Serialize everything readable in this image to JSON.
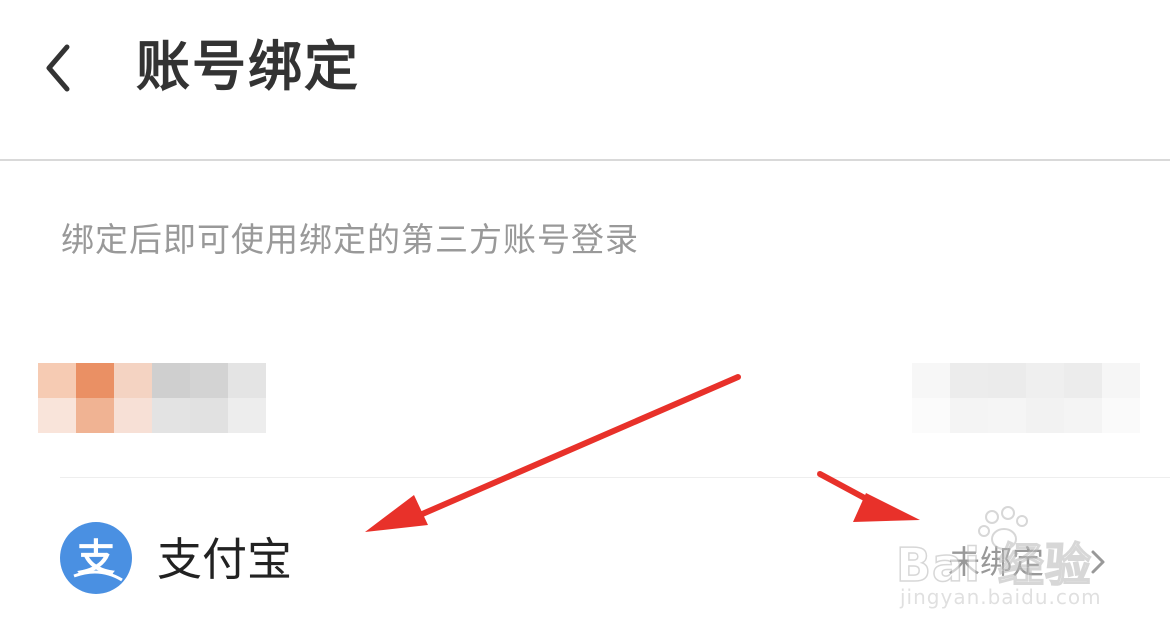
{
  "header": {
    "back_icon": "chevron-left-icon",
    "title": "账号绑定"
  },
  "hint": "绑定后即可使用绑定的第三方账号登录",
  "accounts": [
    {
      "obscured": true
    },
    {
      "icon": "alipay-icon",
      "icon_color": "#4a90e2",
      "icon_glyph": "支",
      "label": "支付宝",
      "status": "未绑定",
      "chevron": "chevron-right-icon"
    }
  ],
  "annotations": {
    "arrow_color": "#e8312a",
    "arrows": 2
  },
  "watermark": {
    "main": "Bai 经验",
    "sub": "jingyan.baidu.com"
  }
}
